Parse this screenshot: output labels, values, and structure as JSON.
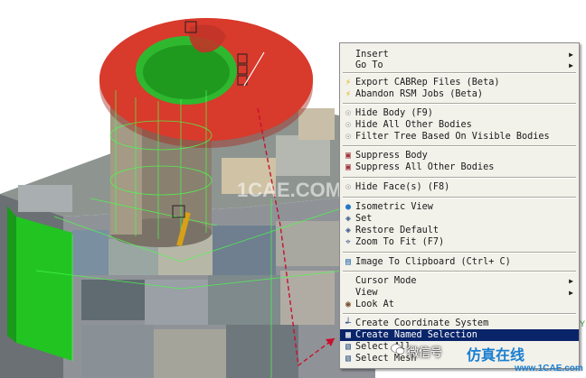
{
  "menu": {
    "items": [
      {
        "label": "Insert",
        "submenu": true,
        "icon": ""
      },
      {
        "label": "Go To",
        "submenu": true,
        "icon": ""
      },
      {
        "label": "Export CABRep Files (Beta)",
        "icon": "lightning-icon"
      },
      {
        "label": "Abandon RSM Jobs (Beta)",
        "icon": "lightning-icon"
      },
      {
        "label": "Hide Body (F9)",
        "icon": "bulb-icon"
      },
      {
        "label": "Hide All Other Bodies",
        "icon": "bulb-icon"
      },
      {
        "label": "Filter Tree Based On Visible Bodies",
        "icon": "bulb-icon"
      },
      {
        "label": "Suppress Body",
        "icon": "suppress-icon"
      },
      {
        "label": "Suppress All Other Bodies",
        "icon": "suppress-icon"
      },
      {
        "label": "Hide Face(s) (F8)",
        "icon": "bulb-icon"
      },
      {
        "label": "Isometric View",
        "icon": "sphere-icon"
      },
      {
        "label": "Set",
        "icon": "iso-icon"
      },
      {
        "label": "Restore Default",
        "icon": "iso-icon"
      },
      {
        "label": "Zoom To Fit (F7)",
        "icon": "zoom-icon"
      },
      {
        "label": "Image To Clipboard (Ctrl+ C)",
        "icon": "camera-icon"
      },
      {
        "label": "Cursor Mode",
        "submenu": true,
        "icon": ""
      },
      {
        "label": "View",
        "submenu": true,
        "icon": ""
      },
      {
        "label": "Look At",
        "icon": "look-icon"
      },
      {
        "label": "Create Coordinate System",
        "icon": "axes-icon"
      },
      {
        "label": "Create Named Selection",
        "icon": "named-selection-icon",
        "highlighted": true
      },
      {
        "label": "Select All",
        "icon": "select-icon"
      },
      {
        "label": "Select Mesh",
        "icon": "select-icon"
      }
    ]
  },
  "watermark": {
    "wechat": "微信号",
    "brand": "仿真在线",
    "url": "www.1CAE.com",
    "center": "1CAE.COM"
  },
  "axis_label": "Y",
  "colors": {
    "highlight": "#0a246a",
    "menu_bg": "#f2f1ea",
    "flange_red": "#d83a2c",
    "face_green": "#22c422",
    "body_gray": "#a9abb2"
  }
}
